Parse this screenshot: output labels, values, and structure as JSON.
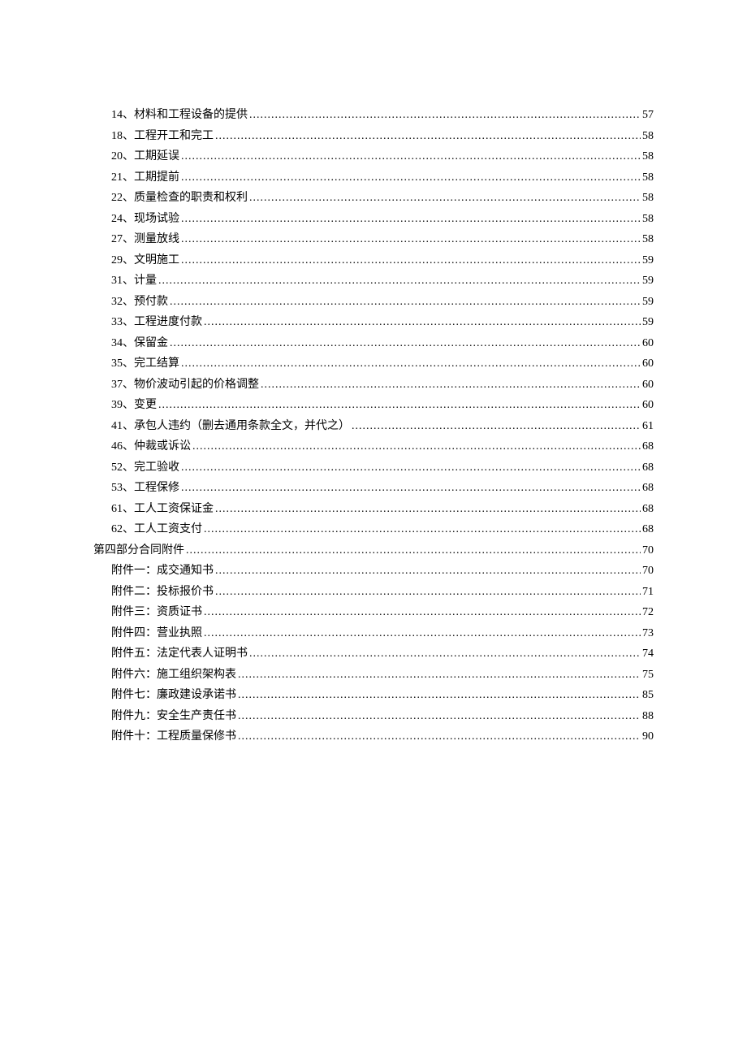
{
  "toc": [
    {
      "indent": true,
      "label": "14、材料和工程设备的提供",
      "page": "57"
    },
    {
      "indent": true,
      "label": "18、工程开工和完工",
      "page": "58"
    },
    {
      "indent": true,
      "label": "20、工期延误",
      "page": "58"
    },
    {
      "indent": true,
      "label": "21、工期提前",
      "page": "58"
    },
    {
      "indent": true,
      "label": "22、质量检查的职责和权利",
      "page": "58"
    },
    {
      "indent": true,
      "label": "24、现场试验",
      "page": "58"
    },
    {
      "indent": true,
      "label": "27、测量放线",
      "page": "58"
    },
    {
      "indent": true,
      "label": "29、文明施工",
      "page": "59"
    },
    {
      "indent": true,
      "label": "31、计量",
      "page": "59"
    },
    {
      "indent": true,
      "label": "32、预付款",
      "page": "59"
    },
    {
      "indent": true,
      "label": "33、工程进度付款",
      "page": "59"
    },
    {
      "indent": true,
      "label": "34、保留金",
      "page": "60"
    },
    {
      "indent": true,
      "label": "35、完工结算",
      "page": "60"
    },
    {
      "indent": true,
      "label": "37、物价波动引起的价格调整",
      "page": "60"
    },
    {
      "indent": true,
      "label": "39、变更",
      "page": "60"
    },
    {
      "indent": true,
      "label": "41、承包人违约（删去通用条款全文，并代之）",
      "page": "61"
    },
    {
      "indent": true,
      "label": "46、仲裁或诉讼",
      "page": "68"
    },
    {
      "indent": true,
      "label": "52、完工验收",
      "page": "68"
    },
    {
      "indent": true,
      "label": "53、工程保修",
      "page": "68"
    },
    {
      "indent": true,
      "label": "61、工人工资保证金",
      "page": "68"
    },
    {
      "indent": true,
      "label": "62、工人工资支付",
      "page": "68"
    },
    {
      "indent": false,
      "label": "第四部分合同附件 ",
      "page": "70"
    },
    {
      "indent": true,
      "label": "附件一：成交通知书",
      "page": "70"
    },
    {
      "indent": true,
      "label": "附件二：投标报价书",
      "page": "71"
    },
    {
      "indent": true,
      "label": "附件三：资质证书",
      "page": "72"
    },
    {
      "indent": true,
      "label": "附件四：营业执照",
      "page": "73"
    },
    {
      "indent": true,
      "label": "附件五：法定代表人证明书",
      "page": "74"
    },
    {
      "indent": true,
      "label": "附件六：施工组织架构表",
      "page": "75"
    },
    {
      "indent": true,
      "label": "附件七：廉政建设承诺书",
      "page": "85"
    },
    {
      "indent": true,
      "label": "附件九：安全生产责任书",
      "page": "88"
    },
    {
      "indent": true,
      "label": "附件十：工程质量保修书",
      "page": "90"
    }
  ]
}
